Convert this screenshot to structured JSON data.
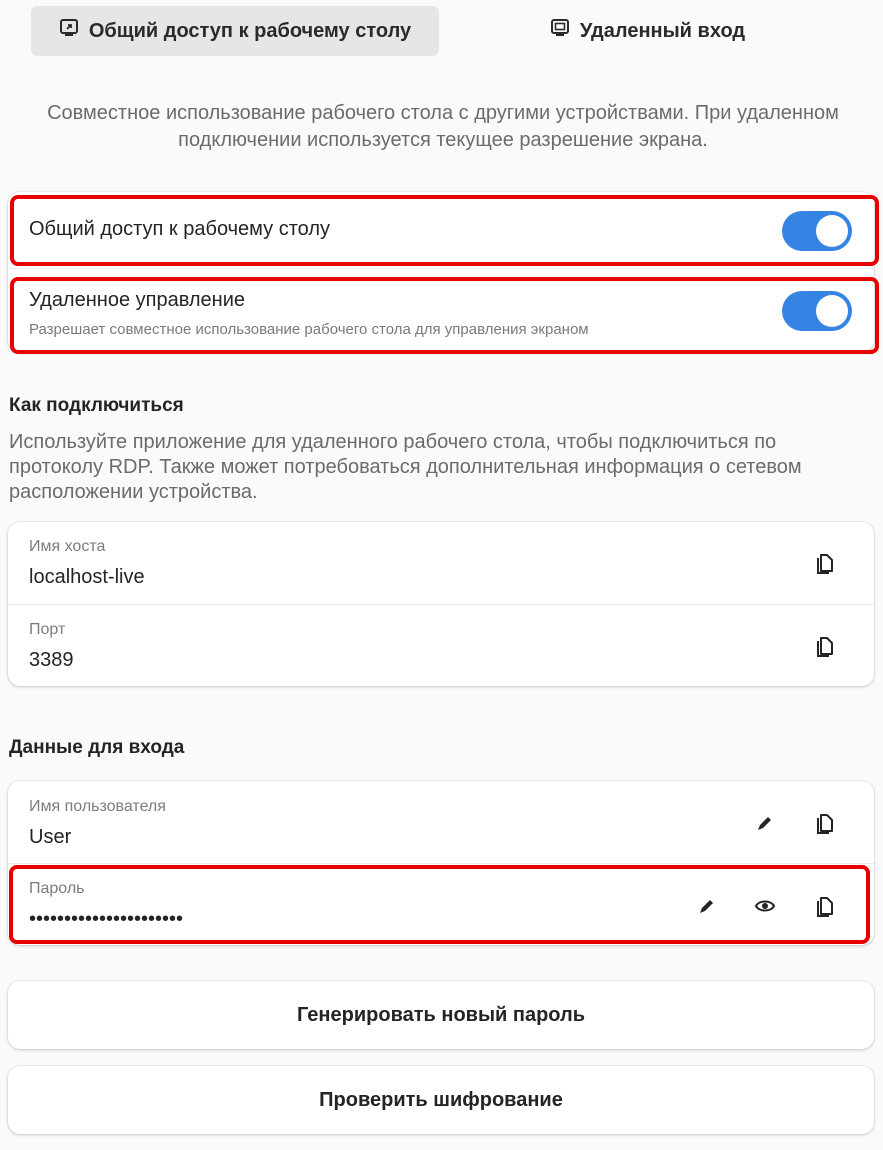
{
  "tabs": {
    "sharing": {
      "label": "Общий доступ к рабочему столу",
      "icon": "screen-share-icon"
    },
    "remote_login": {
      "label": "Удаленный вход",
      "icon": "remote-desktop-icon"
    }
  },
  "description": "Совместное использование рабочего стола с другими устройствами. При удаленном подключении используется текущее разрешение экрана.",
  "toggles": {
    "desktop_sharing": {
      "label": "Общий доступ к рабочему столу",
      "on": true
    },
    "remote_control": {
      "label": "Удаленное управление",
      "sublabel": "Разрешает совместное использование рабочего стола для управления экраном",
      "on": true
    }
  },
  "how_to_connect": {
    "heading": "Как подключиться",
    "text": "Используйте приложение для удаленного рабочего стола, чтобы подключиться по протоколу RDP. Также может потребоваться дополнительная информация о сетевом расположении устройства.",
    "hostname": {
      "label": "Имя хоста",
      "value": "localhost-live"
    },
    "port": {
      "label": "Порт",
      "value": "3389"
    }
  },
  "credentials": {
    "heading": "Данные для входа",
    "username": {
      "label": "Имя пользователя",
      "value": "User"
    },
    "password": {
      "label": "Пароль",
      "value": "••••••••••••••••••••••"
    }
  },
  "buttons": {
    "generate_password": "Генерировать новый пароль",
    "verify_encryption": "Проверить шифрование"
  },
  "colors": {
    "accent": "#3584e4",
    "highlight": "#e80000"
  }
}
